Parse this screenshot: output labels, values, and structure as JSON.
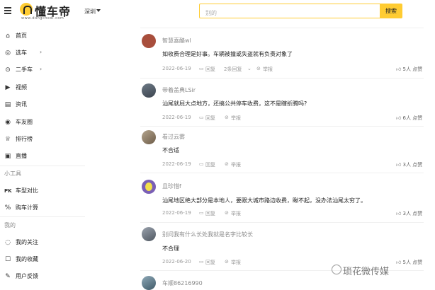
{
  "header": {
    "logo_text": "懂车帝",
    "logo_sub": "www.dongchedi.com",
    "city": "深圳",
    "search_placeholder": "别的",
    "search_button": "搜索"
  },
  "sidebar": {
    "items": [
      {
        "label": "首页",
        "icon": "home-icon"
      },
      {
        "label": "选车",
        "icon": "car-select-icon"
      },
      {
        "label": "二手车",
        "icon": "used-car-icon"
      },
      {
        "label": "视频",
        "icon": "video-icon"
      },
      {
        "label": "资讯",
        "icon": "news-icon"
      },
      {
        "label": "车友圈",
        "icon": "community-icon"
      },
      {
        "label": "排行榜",
        "icon": "trophy-icon"
      },
      {
        "label": "直播",
        "icon": "live-icon"
      }
    ],
    "tools_title": "小工具",
    "tools": [
      {
        "label": "车型对比",
        "icon": "compare-icon"
      },
      {
        "label": "购车计算",
        "icon": "calculator-icon"
      }
    ],
    "mine_title": "我的",
    "mine": [
      {
        "label": "我的关注",
        "icon": "follow-icon"
      },
      {
        "label": "我的收藏",
        "icon": "favorite-icon"
      },
      {
        "label": "用户反馈",
        "icon": "feedback-icon"
      }
    ]
  },
  "comments": [
    {
      "user": "智慧喜酪wl",
      "text": "如收费合理是好事。车辆被撞或失盗就有负责对象了",
      "date": "2022-06-19",
      "reply": "回复",
      "replies": "2条回复",
      "report": "举报",
      "likes": "5人 点赞",
      "avatar_color": "#a84e3c"
    },
    {
      "user": "带着盖典LSir",
      "text": "汕尾就屁大点地方，还搞公共停车收费，这不是瞎折腾吗?",
      "date": "2022-06-19",
      "reply": "回复",
      "replies": "",
      "report": "举报",
      "likes": "6人 点赞",
      "avatar_color": "#4a5563"
    },
    {
      "user": "看过云雾",
      "text": "不合适",
      "date": "2022-06-19",
      "reply": "回复",
      "replies": "",
      "report": "举报",
      "likes": "3人 点赞",
      "avatar_color": "#8c7b68"
    },
    {
      "user": "且珍惜f",
      "text": "汕尾地区绝大部分是本地人，要跟大城市路边收费，瞅不起，没办法汕尾太穷了。",
      "date": "2022-06-19",
      "reply": "回复",
      "replies": "",
      "report": "举报",
      "likes": "3人 点赞",
      "avatar_color": "#7a5fb5"
    },
    {
      "user": "别问我有什么长处我就是名字比较长",
      "text": "不合理",
      "date": "2022-06-20",
      "reply": "回复",
      "replies": "",
      "report": "举报",
      "likes": "5人 点赞",
      "avatar_color": "#6b7380"
    },
    {
      "user": "车顺86216990",
      "text": "",
      "date": "",
      "reply": "",
      "replies": "",
      "report": "",
      "likes": "",
      "avatar_color": "#5d7a8c"
    }
  ],
  "watermark": "琐花微传媒"
}
